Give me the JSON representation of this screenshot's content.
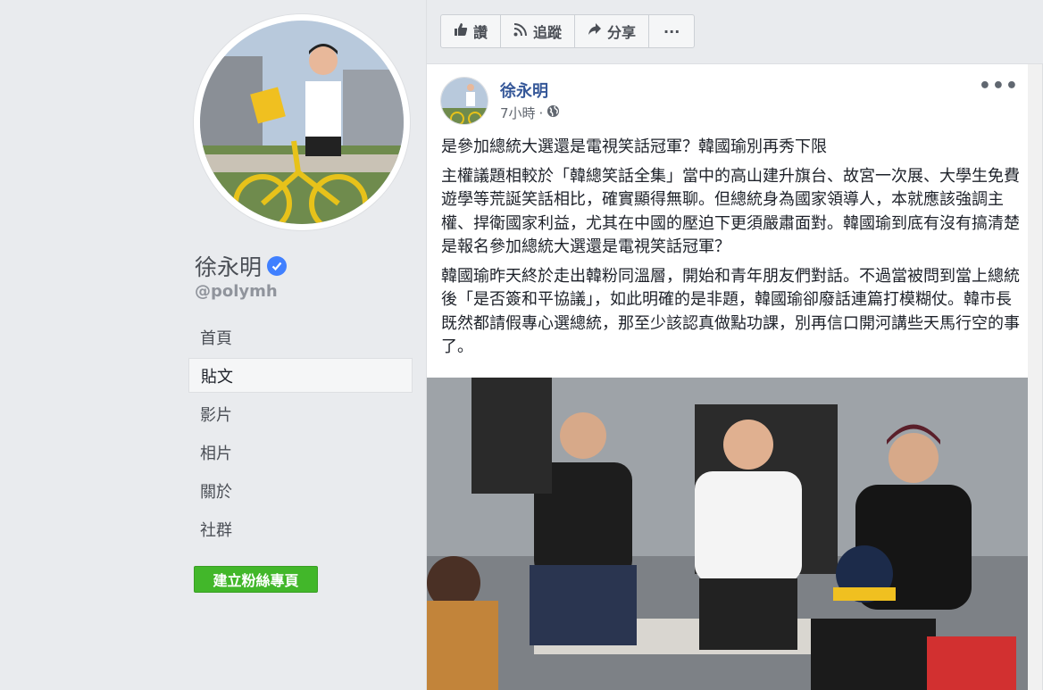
{
  "profile": {
    "name": "徐永明",
    "handle": "@polymh",
    "avatar_icon": "profile-photo"
  },
  "nav": {
    "items": [
      {
        "label": "首頁"
      },
      {
        "label": "貼文"
      },
      {
        "label": "影片"
      },
      {
        "label": "相片"
      },
      {
        "label": "關於"
      },
      {
        "label": "社群"
      }
    ],
    "active": "貼文"
  },
  "create_page_button": "建立粉絲專頁",
  "actions": {
    "like": "讚",
    "follow": "追蹤",
    "share": "分享",
    "more": "···"
  },
  "post": {
    "author": "徐永明",
    "time": "7小時",
    "separator": "·",
    "menu": "•••",
    "headline": "是參加總統大選還是電視笑話冠軍？韓國瑜別再秀下限",
    "paragraph1": "主權議題相較於「韓總笑話全集」當中的高山建升旗台、故宮一次展、大學生免費遊學等荒誕笑話相比，確實顯得無聊。但總統身為國家領導人，本就應該強調主權、捍衛國家利益，尤其在中國的壓迫下更須嚴肅面對。韓國瑜到底有沒有搞清楚是報名參加總統大選還是電視笑話冠軍？",
    "paragraph2": "韓國瑜昨天終於走出韓粉同溫層，開始和青年朋友們對話。不過當被問到當上總統後「是否簽和平協議」，如此明確的是非題，韓國瑜卻廢話連篇打模糊仗。韓市長既然都請假專心選總統，那至少該認真做點功課，別再信口開河講些天馬行空的事了。"
  },
  "colors": {
    "link": "#365899",
    "green": "#42b72a",
    "verified": "#4080ff",
    "background": "#e9ebee"
  }
}
